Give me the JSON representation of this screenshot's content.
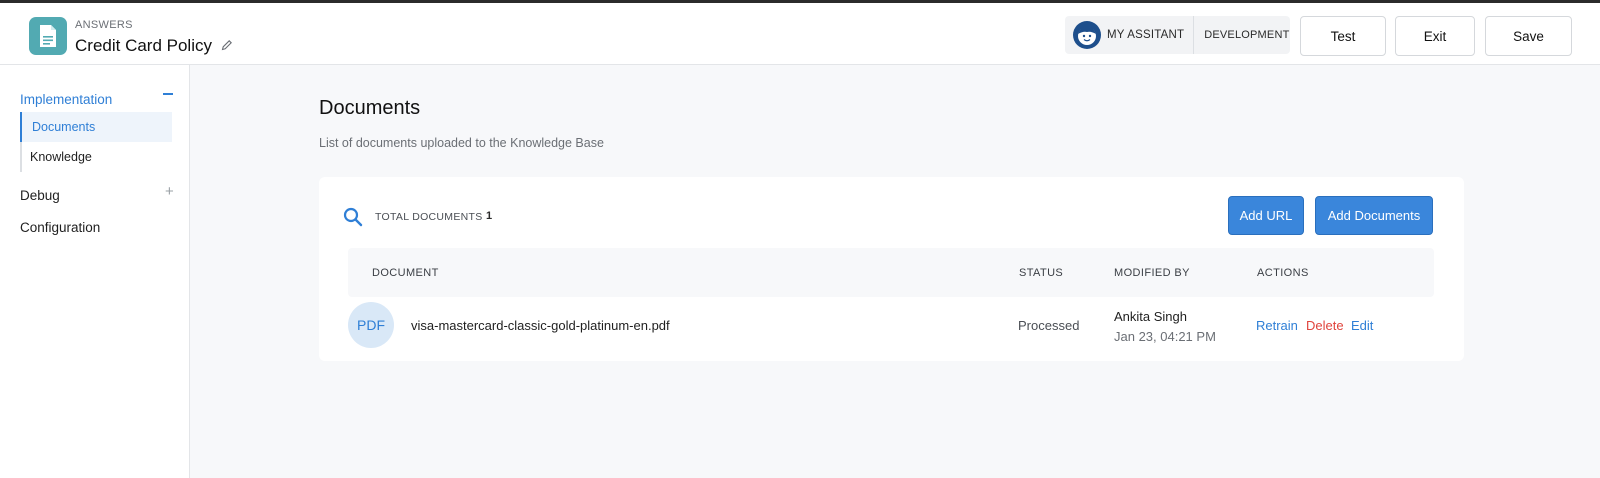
{
  "header": {
    "kicker": "ANSWERS",
    "title": "Credit Card Policy",
    "assistant_label": "MY ASSITANT",
    "env_label": "DEVELOPMENT",
    "test_label": "Test",
    "exit_label": "Exit",
    "save_label": "Save"
  },
  "sidebar": {
    "implementation": "Implementation",
    "items": [
      {
        "label": "Documents",
        "active": true
      },
      {
        "label": "Knowledge",
        "active": false
      }
    ],
    "debug": "Debug",
    "configuration": "Configuration"
  },
  "main": {
    "title": "Documents",
    "subtitle": "List of documents uploaded to the Knowledge Base",
    "total_label": "TOTAL DOCUMENTS",
    "total_count": "1",
    "add_url_label": "Add URL",
    "add_documents_label": "Add Documents",
    "columns": [
      "DOCUMENT",
      "STATUS",
      "MODIFIED BY",
      "ACTIONS"
    ],
    "rows": [
      {
        "badge": "PDF",
        "name": "visa-mastercard-classic-gold-platinum-en.pdf",
        "status": "Processed",
        "modified_by": "Ankita Singh",
        "modified_at": "Jan 23, 04:21 PM",
        "actions": [
          "Retrain",
          "Delete",
          "Edit"
        ]
      }
    ]
  },
  "colors": {
    "accent": "#2f7fd6",
    "primary_button": "#3a86db",
    "danger": "#e0443d",
    "app_icon": "#52aab2"
  },
  "icons": [
    "document-icon",
    "edit-pencil-icon",
    "assistant-avatar-icon",
    "minus-icon",
    "plus-icon",
    "search-icon"
  ]
}
